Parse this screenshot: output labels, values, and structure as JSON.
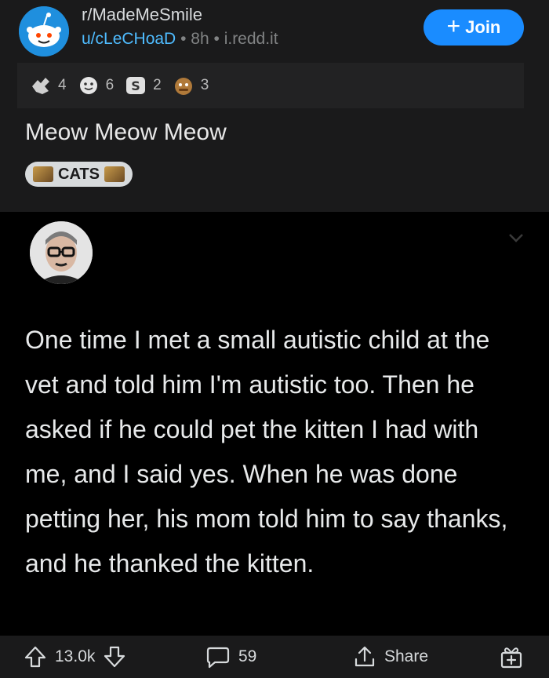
{
  "header": {
    "subreddit": "r/MadeMeSmile",
    "user": "u/cLeCHoaD",
    "separator1": "•",
    "age": "8h",
    "separator2": "•",
    "domain": "i.redd.it",
    "join_label": "Join",
    "join_plus": "+"
  },
  "awards": [
    {
      "icon": "helpful-award-icon",
      "count": "4"
    },
    {
      "icon": "wholesome-award-icon",
      "count": "6"
    },
    {
      "icon": "silver-award-icon",
      "count": "2"
    },
    {
      "icon": "hugz-award-icon",
      "count": "3"
    }
  ],
  "post": {
    "title": "Meow Meow Meow",
    "flair": "CATS"
  },
  "tweet": {
    "text": "One time I met a small autistic child at the vet and told him I'm autistic too. Then he asked if he could pet the kitten I had with me, and I said yes. When he was done petting her, his mom told him to say thanks, and he thanked the kitten."
  },
  "footer": {
    "upvotes": "13.0k",
    "comments": "59",
    "share_label": "Share"
  },
  "colors": {
    "background": "#1a1a1b",
    "accent": "#1a8cff",
    "username": "#4fbcff",
    "image_bg": "#000000"
  }
}
